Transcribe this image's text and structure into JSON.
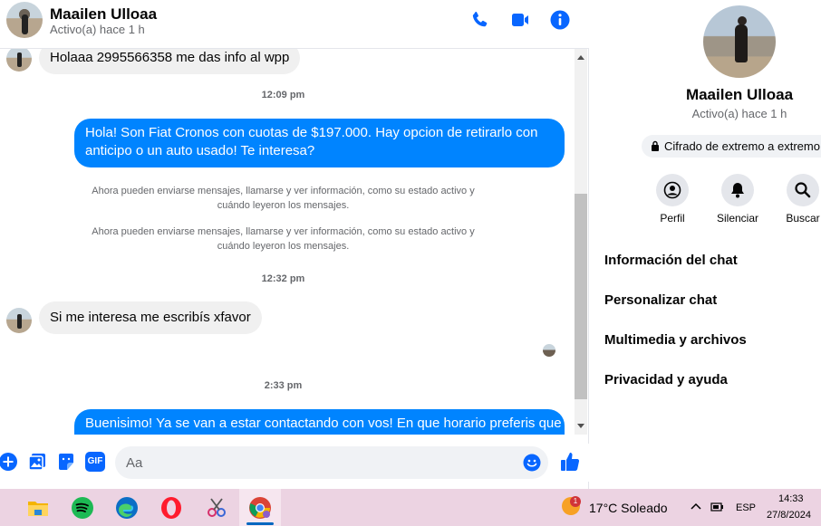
{
  "header": {
    "name": "Maailen Ulloaa",
    "status": "Activo(a) hace 1 h"
  },
  "messages": {
    "m1": "Holaaa 2995566358 me das info al wpp",
    "t1": "12:09 pm",
    "m2": "Hola! Son Fiat Cronos con cuotas de $197.000. Hay opcion de retirarlo con anticipo o un auto usado! Te interesa?",
    "sys1": "Ahora pueden enviarse mensajes, llamarse y ver información, como su estado activo y cuándo leyeron los mensajes.",
    "sys2": "Ahora pueden enviarse mensajes, llamarse y ver información, como su estado activo y cuándo leyeron los mensajes.",
    "t2": "12:32 pm",
    "m3": "Si me interesa me escribís xfavor",
    "t3": "2:33 pm",
    "m4": "Buenisimo! Ya se van a estar contactando con vos! En que horario preferis que"
  },
  "composer": {
    "placeholder": "Aa",
    "gif_label": "GIF"
  },
  "profile": {
    "name": "Maailen Ulloaa",
    "status": "Activo(a) hace 1 h",
    "encryption": "Cifrado de extremo a extremo",
    "actions": [
      "Perfil",
      "Silenciar",
      "Buscar"
    ],
    "menu": [
      "Información del chat",
      "Personalizar chat",
      "Multimedia y archivos",
      "Privacidad y ayuda"
    ]
  },
  "taskbar": {
    "weather_badge": "1",
    "weather": "17°C  Soleado",
    "lang": "ESP",
    "time": "14:33",
    "date": "27/8/2024"
  },
  "colors": {
    "accent": "#0084ff",
    "icon_blue": "#0866ff",
    "taskbar": "#ecd3e2"
  }
}
